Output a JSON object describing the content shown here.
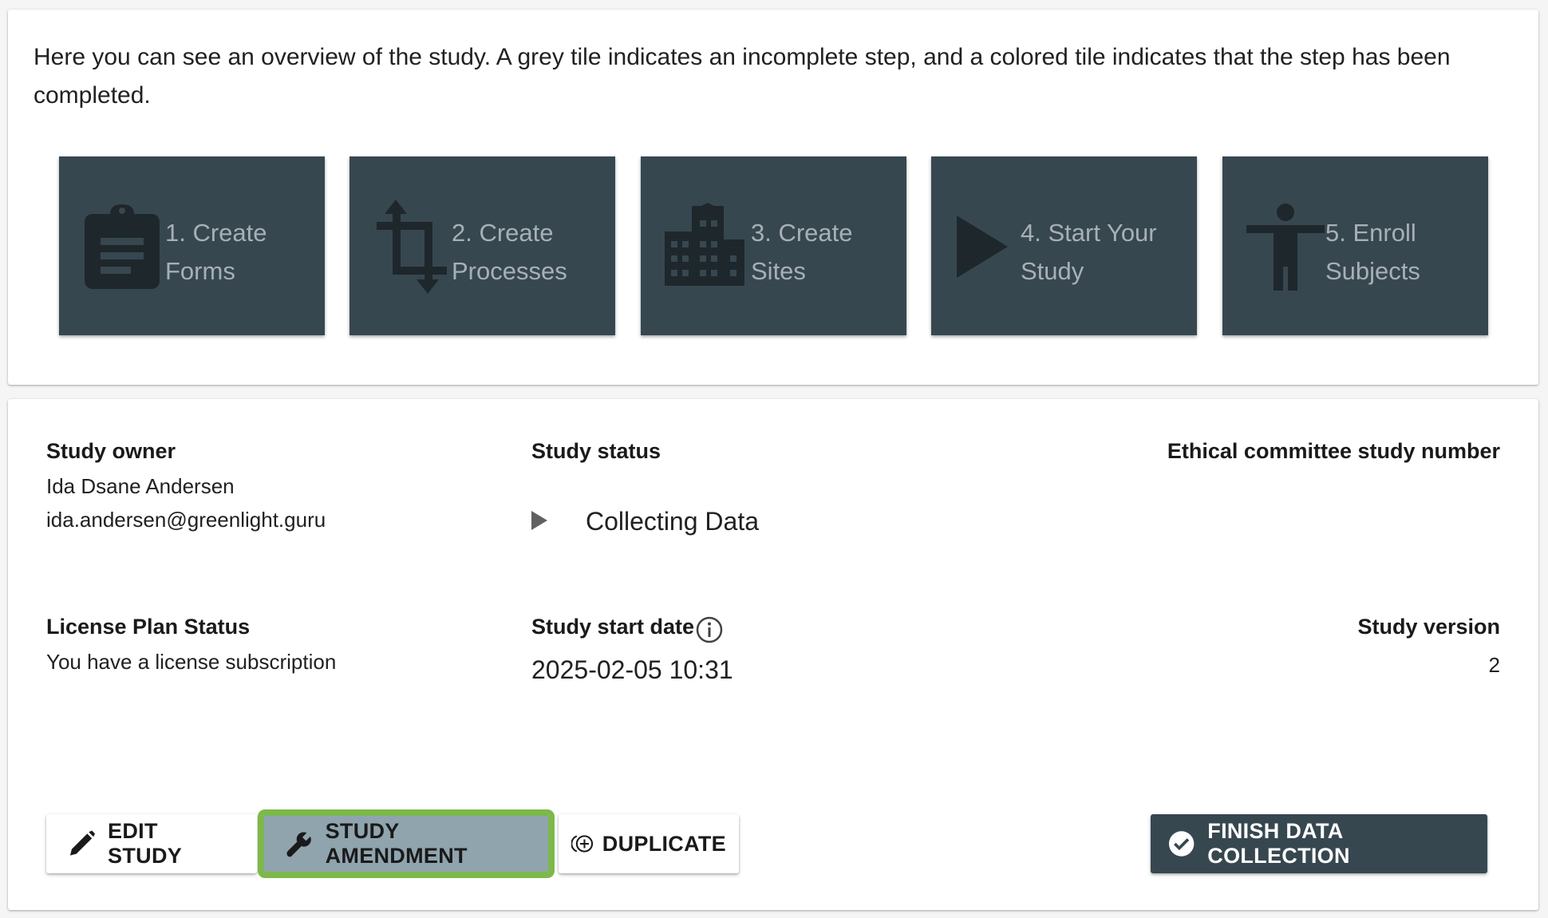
{
  "overview": {
    "intro_text": "Here you can see an overview of the study. A grey tile indicates an incomplete step, and a colored tile indicates that the step has been completed.",
    "steps": [
      {
        "label": "1. Create\nForms",
        "icon": "clipboard-icon"
      },
      {
        "label": "2. Create\nProcesses",
        "icon": "crop-icon"
      },
      {
        "label": "3. Create\nSites",
        "icon": "building-icon"
      },
      {
        "label": "4. Start Your\nStudy",
        "icon": "play-icon"
      },
      {
        "label": "5. Enroll\nSubjects",
        "icon": "person-icon"
      }
    ],
    "colors": {
      "tile_bg": "#37474f",
      "tile_text": "#a6b0b6",
      "tile_icon": "#1e272b"
    }
  },
  "details": {
    "owner": {
      "label": "Study owner",
      "name": "Ida Dsane Andersen",
      "email": "ida.andersen@greenlight.guru"
    },
    "status": {
      "label": "Study status",
      "value": "Collecting Data",
      "icon": "play-icon"
    },
    "ethics": {
      "label": "Ethical committee study number",
      "value": ""
    },
    "license": {
      "label": "License Plan Status",
      "value": "You have a license subscription"
    },
    "start_date": {
      "label": "Study start date",
      "value": "2025-02-05 10:31",
      "icon": "info-icon"
    },
    "version": {
      "label": "Study version",
      "value": "2"
    }
  },
  "actions": {
    "edit_label": "EDIT STUDY",
    "amendment_label": "STUDY AMENDMENT",
    "duplicate_label": "DUPLICATE",
    "finish_label": "FINISH DATA COLLECTION",
    "colors": {
      "highlight": "#7cb84a",
      "amendment_bg": "#90a4ae",
      "finish_bg": "#37474f"
    }
  }
}
